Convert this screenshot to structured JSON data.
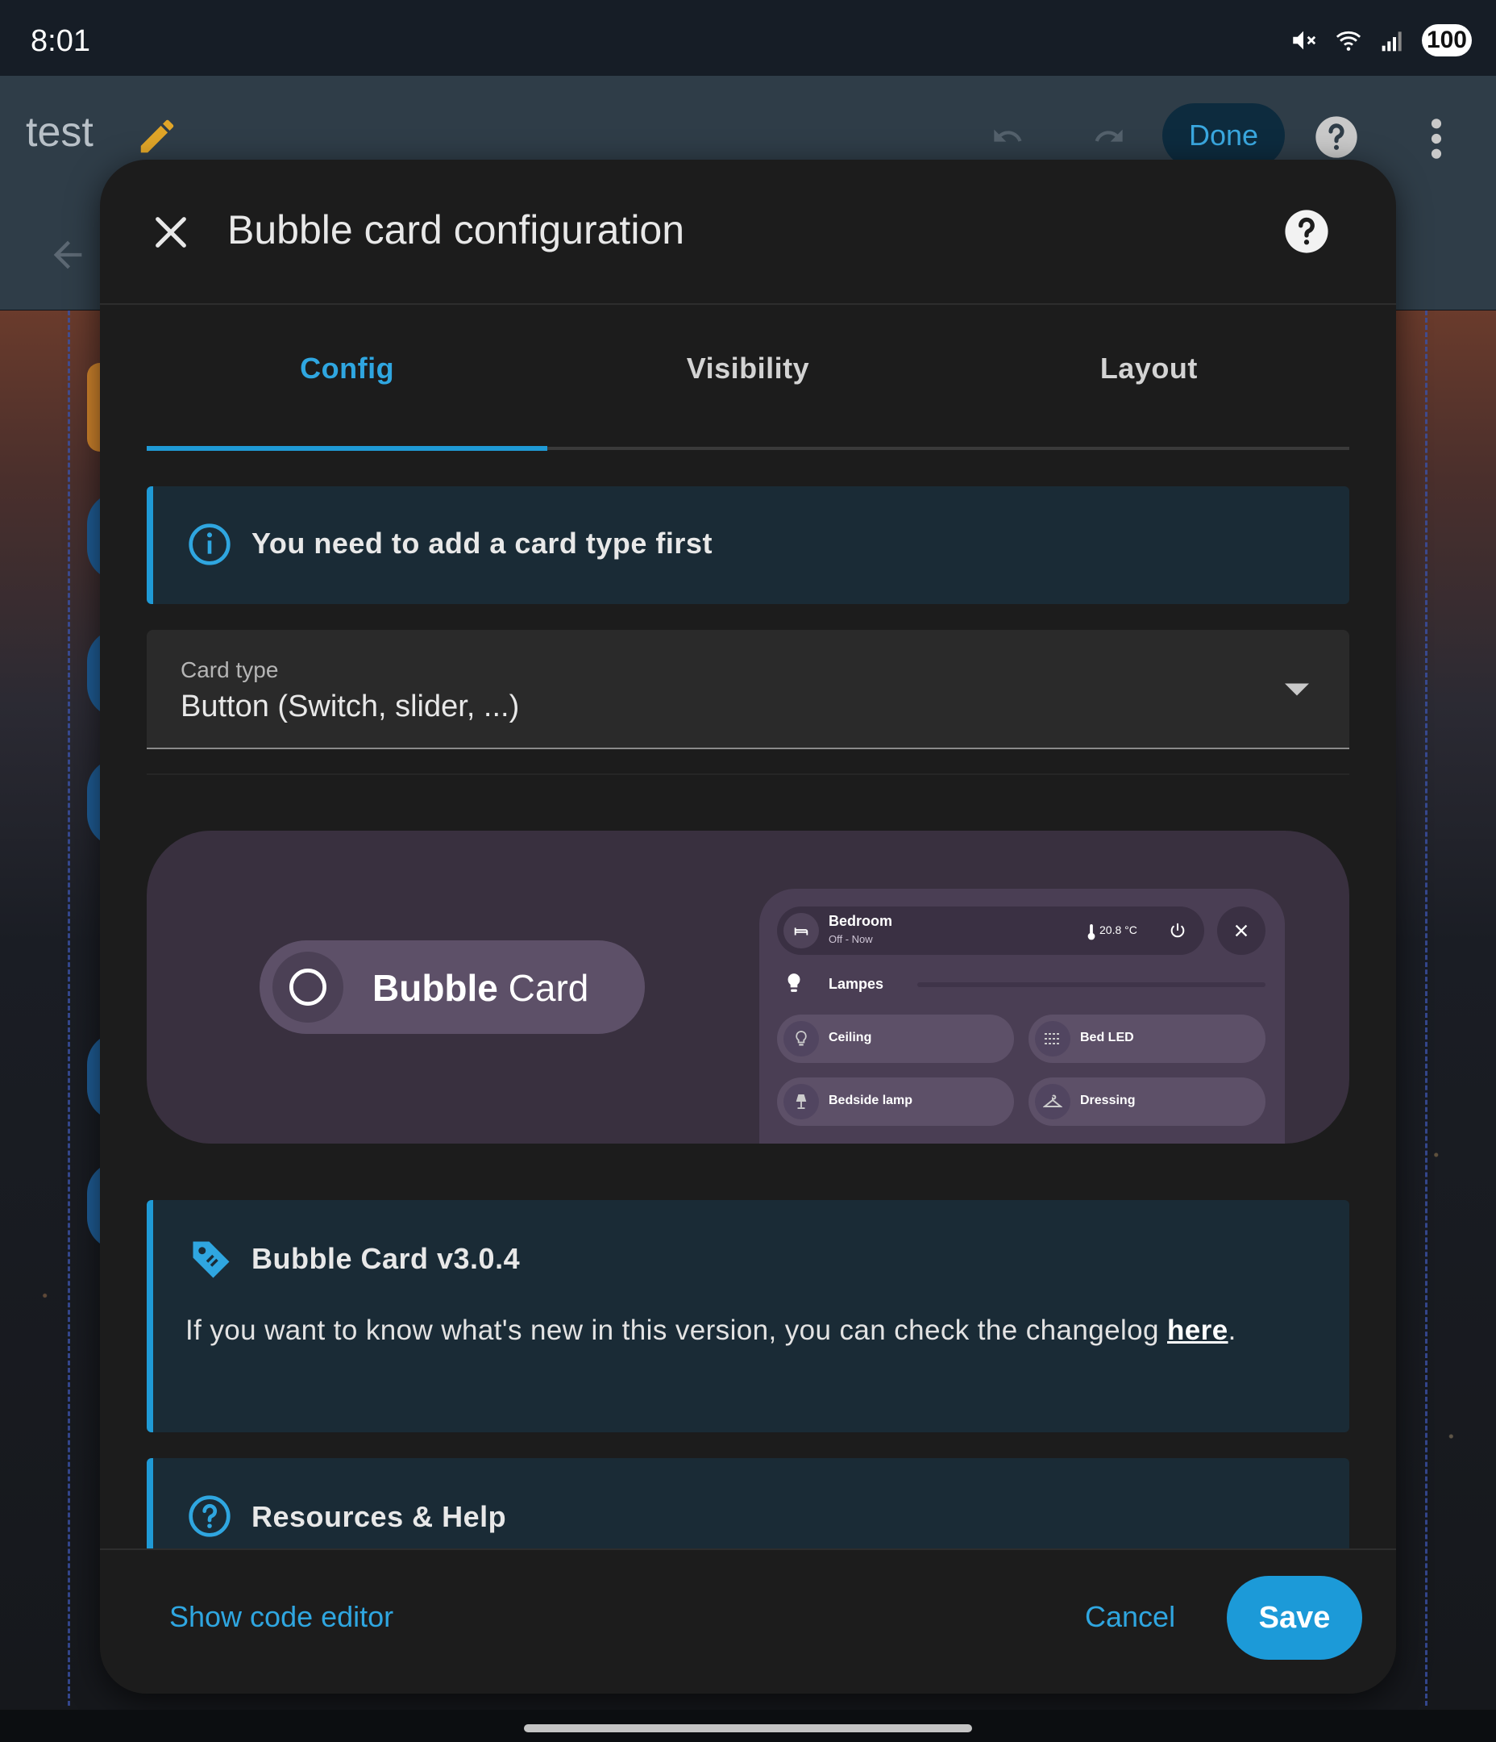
{
  "status_bar": {
    "time": "8:01",
    "battery": "100",
    "icons": [
      "mute-icon",
      "wifi-icon",
      "signal-icon"
    ]
  },
  "dashboard": {
    "title": "test",
    "done_label": "Done",
    "icons": [
      "pencil-icon",
      "undo-icon",
      "redo-icon",
      "help-icon",
      "more-vert-icon",
      "arrow-back-icon"
    ]
  },
  "dialog": {
    "title": "Bubble card configuration",
    "tabs": [
      {
        "label": "Config",
        "active": true
      },
      {
        "label": "Visibility",
        "active": false
      },
      {
        "label": "Layout",
        "active": false
      }
    ],
    "alert_card_type": "You need to add a card type first",
    "card_type": {
      "label": "Card type",
      "value": "Button (Switch, slider, ...)"
    },
    "preview": {
      "button_bold": "Bubble",
      "button_rest": " Card",
      "mock": {
        "room": "Bedroom",
        "room_status": "Off - Now",
        "temperature": "20.8 °C",
        "lampes": "Lampes",
        "pills": [
          "Ceiling",
          "Bed LED",
          "Bedside lamp",
          "Dressing"
        ]
      }
    },
    "version": {
      "title": "Bubble Card v3.0.4",
      "body": "If you want to know what's new in this version, you can check the changelog ",
      "link": "here",
      "period": "."
    },
    "resources_title": "Resources & Help",
    "footer": {
      "code_editor": "Show code editor",
      "cancel": "Cancel",
      "save": "Save"
    }
  },
  "colors": {
    "accent": "#1f9ad6",
    "dialog_bg": "#1c1c1c",
    "alert_bg": "#1a2b36",
    "preview_bg": "#39303f"
  }
}
